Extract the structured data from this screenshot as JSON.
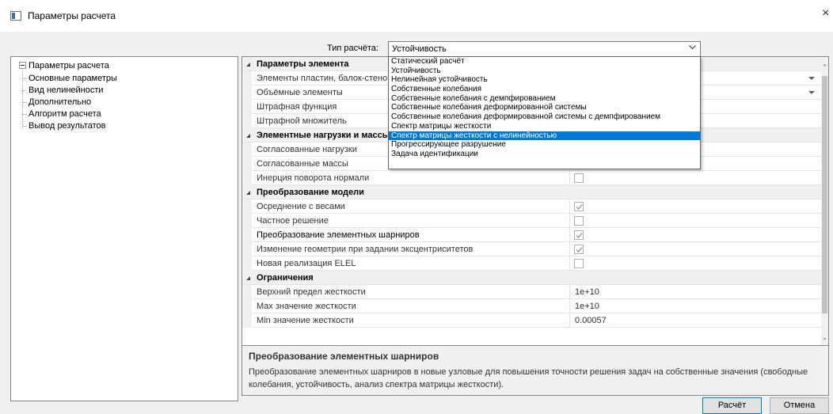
{
  "window": {
    "title": "Параметры расчета",
    "close": "×"
  },
  "calc_type": {
    "label": "Тип расчёта:",
    "value": "Устойчивость",
    "options": [
      "Статический расчёт",
      "Устойчивость",
      "Нелинейная устойчивость",
      "Собственные колебания",
      "Собственные колебания с демпфированием",
      "Собственные колебания деформированной системы",
      "Собственные колебания деформированной системы с демпфированием",
      "Спектр матрицы жесткости",
      "Спектр матрицы жесткости с нелинейностью",
      "Прогрессирующее разрушение",
      "Задача идентификации"
    ],
    "highlighted_option": "Спектр матрицы жесткости с нелинейностью"
  },
  "tree": {
    "root": "Параметры расчета",
    "children": [
      "Основные параметры",
      "Вид нелинейности",
      "Дополнительно",
      "Алгоритм расчета",
      "Вывод результатов"
    ]
  },
  "grid": {
    "categories": [
      {
        "label": "Параметры элемента",
        "rows": [
          {
            "name": "Элементы пластин, балок-стенок",
            "type": "dropdown",
            "value": ""
          },
          {
            "name": "Объёмные элементы",
            "type": "dropdown",
            "value": ""
          },
          {
            "name": "Штрафная функция",
            "type": "text",
            "value": ""
          },
          {
            "name": "Штрафной множитель",
            "type": "text",
            "value": ""
          }
        ]
      },
      {
        "label": "Элементные нагрузки и массы",
        "rows": [
          {
            "name": "Согласованные нагрузки",
            "type": "text",
            "value": ""
          },
          {
            "name": "Согласованные массы",
            "type": "check",
            "checked": true
          },
          {
            "name": "Инерция поворота нормали",
            "type": "check",
            "checked": false
          }
        ]
      },
      {
        "label": "Преобразование модели",
        "rows": [
          {
            "name": "Осреднение с весами",
            "type": "check",
            "checked": true
          },
          {
            "name": "Частное решение",
            "type": "check",
            "checked": false
          },
          {
            "name": "Преобразование элементных шарниров",
            "type": "check",
            "checked": true,
            "selected": true
          },
          {
            "name": "Изменение геометрии при задании эксцентриситетов",
            "type": "check",
            "checked": true
          },
          {
            "name": "Новая реализация ELEL",
            "type": "check",
            "checked": false
          }
        ]
      },
      {
        "label": "Ограничения",
        "rows": [
          {
            "name": "Верхний предел жесткости",
            "type": "text",
            "value": "1e+10"
          },
          {
            "name": "Max значение жесткости",
            "type": "text",
            "value": "1e+10"
          },
          {
            "name": "Min значение жесткости",
            "type": "text",
            "value": "0.00057"
          }
        ]
      }
    ]
  },
  "description": {
    "title": "Преобразование элементных шарниров",
    "text": "Преобразование элементных шарниров в новые узловые для повышения точности решения задач на собственные значения (свободные колебания, устойчивость, анализ спектра матрицы жесткости)."
  },
  "buttons": {
    "calculate": "Расчёт",
    "cancel": "Отмена"
  },
  "colors": {
    "selection": "#0078d7",
    "row_selected": "#cce8ff"
  }
}
